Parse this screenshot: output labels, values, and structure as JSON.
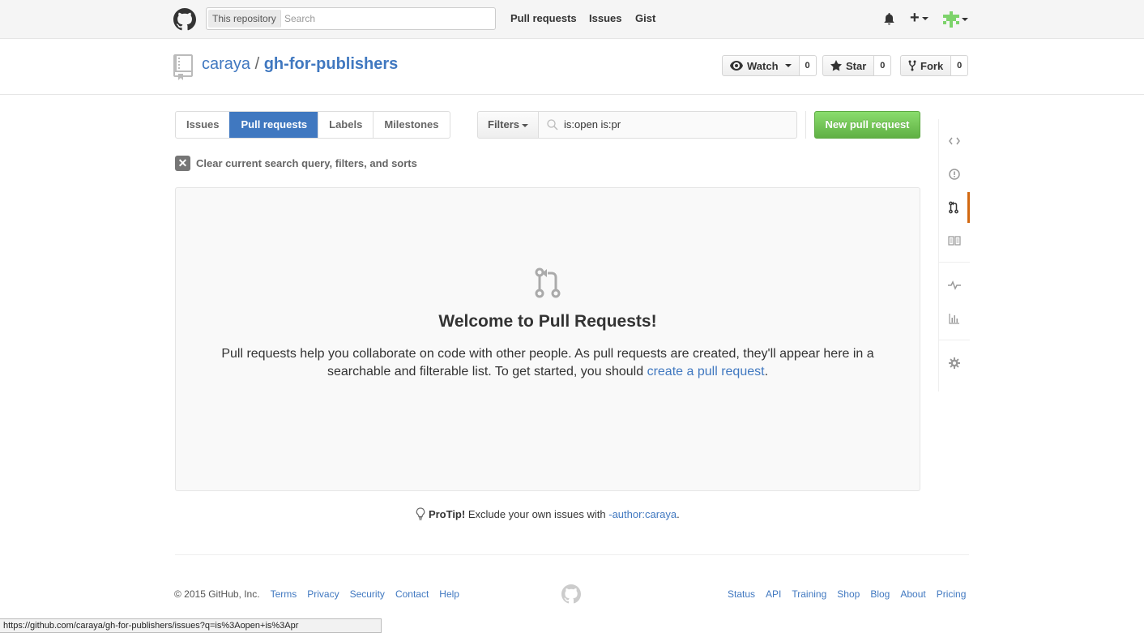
{
  "header": {
    "search_scope": "This repository",
    "search_placeholder": "Search",
    "nav": [
      "Pull requests",
      "Issues",
      "Gist"
    ]
  },
  "repo": {
    "owner": "caraya",
    "separator": "/",
    "name": "gh-for-publishers",
    "watch_label": "Watch",
    "watch_count": "0",
    "star_label": "Star",
    "star_count": "0",
    "fork_label": "Fork",
    "fork_count": "0"
  },
  "subnav": {
    "items": [
      "Issues",
      "Pull requests",
      "Labels",
      "Milestones"
    ],
    "selected": "Pull requests",
    "filters_label": "Filters",
    "query": "is:open is:pr",
    "new_pr_label": "New pull request"
  },
  "clear_filters": "Clear current search query, filters, and sorts",
  "blankslate": {
    "title": "Welcome to Pull Requests!",
    "text_before": "Pull requests help you collaborate on code with other people. As pull requests are created, they'll appear here in a searchable and filterable list. To get started, you should ",
    "link": "create a pull request",
    "text_after": "."
  },
  "protip": {
    "label": "ProTip!",
    "text": " Exclude your own issues with ",
    "link": "-author:caraya",
    "end": "."
  },
  "sidebar": {
    "icons": [
      "code-icon",
      "issue-icon",
      "pull-request-icon",
      "wiki-icon",
      "pulse-icon",
      "graph-icon",
      "settings-icon"
    ],
    "selected": "pull-request-icon",
    "accent": "#d26911"
  },
  "footer": {
    "copyright": "© 2015 GitHub, Inc.",
    "left_links": [
      "Terms",
      "Privacy",
      "Security",
      "Contact",
      "Help"
    ],
    "right_links": [
      "Status",
      "API",
      "Training",
      "Shop",
      "Blog",
      "About",
      "Pricing"
    ]
  },
  "status_url": "https://github.com/caraya/gh-for-publishers/issues?q=is%3Aopen+is%3Apr",
  "colors": {
    "link": "#4078c0",
    "selected_tab": "#4078c0",
    "new_button": "#60b044"
  }
}
